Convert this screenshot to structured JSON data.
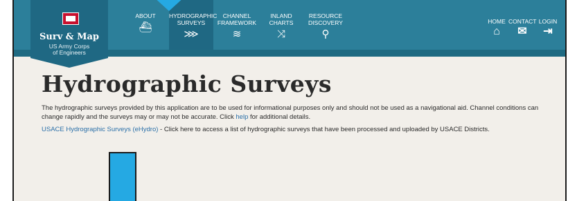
{
  "logo": {
    "title": "Surv & Map",
    "subtitle_line1": "US Army Corps",
    "subtitle_line2": "of Engineers"
  },
  "nav": {
    "items": [
      {
        "line1": "ABOUT",
        "line2": "",
        "icon": "ship-icon"
      },
      {
        "line1": "HYDROGRAPHIC",
        "line2": "SURVEYS",
        "icon": "fish-icon"
      },
      {
        "line1": "CHANNEL",
        "line2": "FRAMEWORK",
        "icon": "channel-icon"
      },
      {
        "line1": "INLAND",
        "line2": "CHARTS",
        "icon": "shuffle-icon"
      },
      {
        "line1": "RESOURCE",
        "line2": "DISCOVERY",
        "icon": "search-icon"
      }
    ],
    "right": [
      {
        "label": "HOME",
        "icon": "home-icon"
      },
      {
        "label": "CONTACT",
        "icon": "mail-icon"
      },
      {
        "label": "LOGIN",
        "icon": "login-icon"
      }
    ]
  },
  "page": {
    "title": "Hydrographic Surveys",
    "intro_part1": "The hydrographic surveys provided by this application are to be used for informational purposes only and should not be used as a navigational aid. Channel conditions can change rapidly and the surveys may or may not be accurate. Click ",
    "intro_link": "help",
    "intro_part2": " for additional details.",
    "ehydro_link": "USACE Hydrographic Surveys (eHydro)",
    "ehydro_text": " - Click here to access a list of hydrographic surveys that have been processed and uploaded by USACE Districts."
  },
  "colors": {
    "nav_bg": "#2c7f9a",
    "nav_active": "#1f6883",
    "pointer": "#25a9e3",
    "link": "#2a6fa8"
  }
}
